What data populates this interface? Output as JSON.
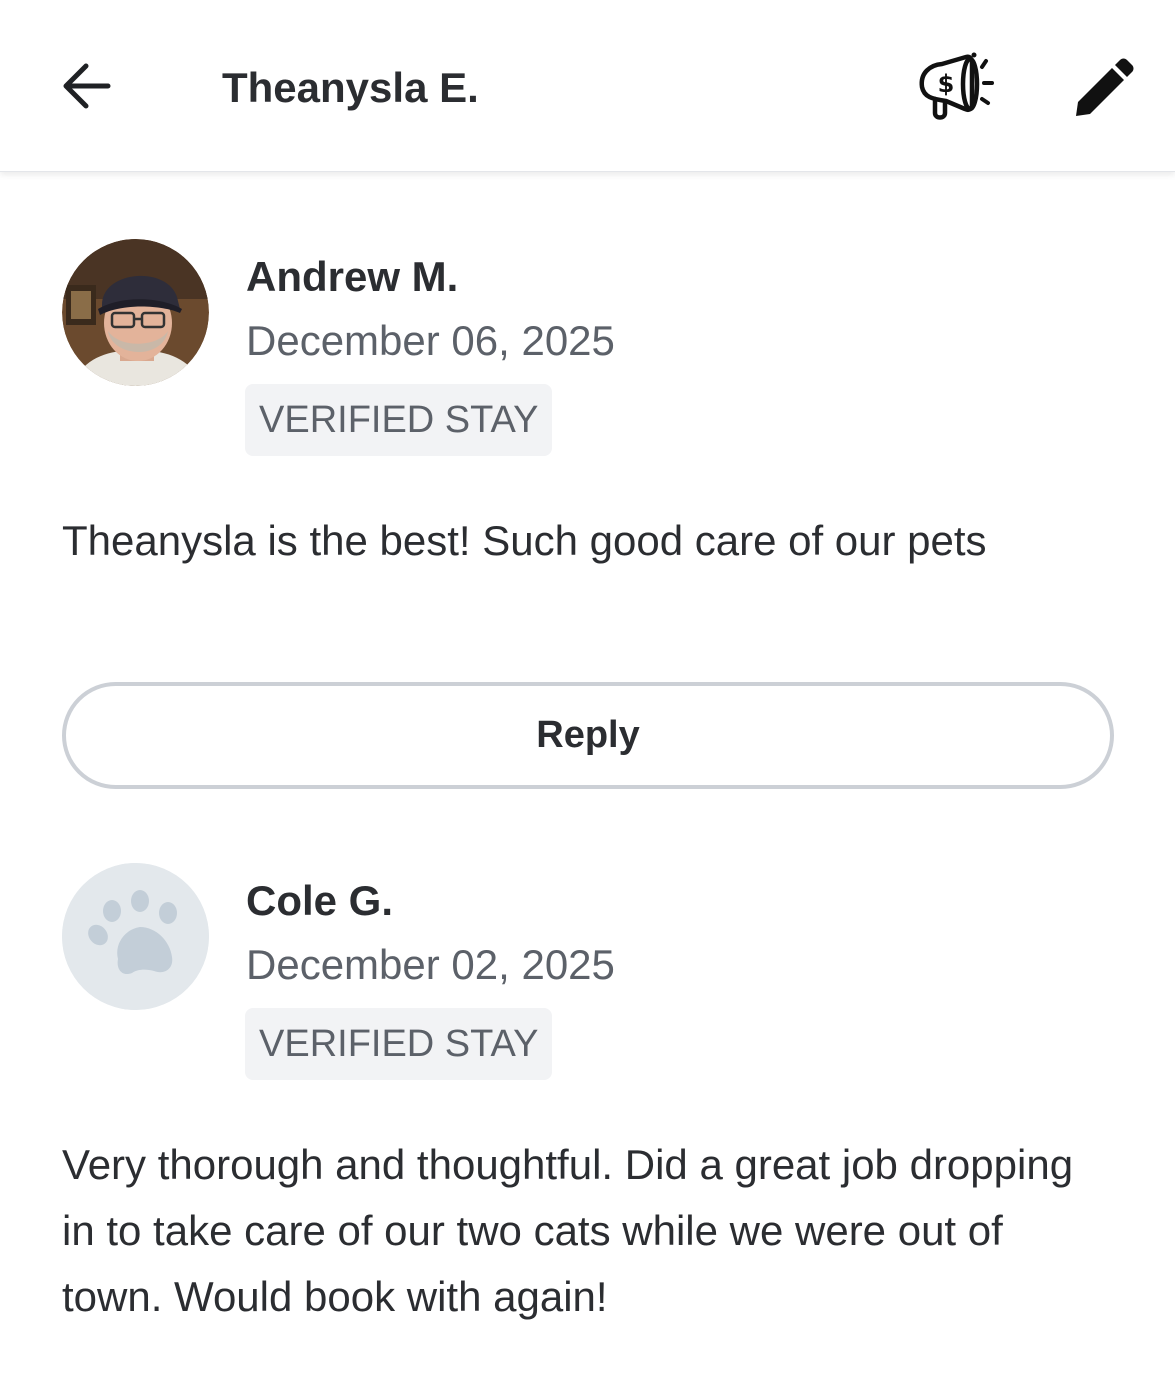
{
  "header": {
    "title": "Theanysla E.",
    "back_icon": "arrow-left-icon",
    "promo_icon": "megaphone-dollar-icon",
    "edit_icon": "pencil-icon"
  },
  "reviews": [
    {
      "name": "Andrew M.",
      "date": "December 06, 2025",
      "badge": "VERIFIED STAY",
      "text": "Theanysla is the best! Such good care of our pets",
      "avatar": "photo"
    },
    {
      "name": "Cole G.",
      "date": "December 02, 2025",
      "badge": "VERIFIED STAY",
      "text": "Very thorough and thoughtful. Did a great job dropping in to take care of our two cats while we were out of town. Would book with again!",
      "avatar": "paw-placeholder-icon"
    }
  ],
  "reply_button": {
    "label": "Reply"
  },
  "colors": {
    "text_primary": "#2b2d31",
    "text_secondary": "#5c6169",
    "badge_bg": "#f2f3f5",
    "reply_border": "#ccd0d6",
    "paw_bg": "#e3e8ec",
    "paw_fg": "#c3ced8"
  }
}
